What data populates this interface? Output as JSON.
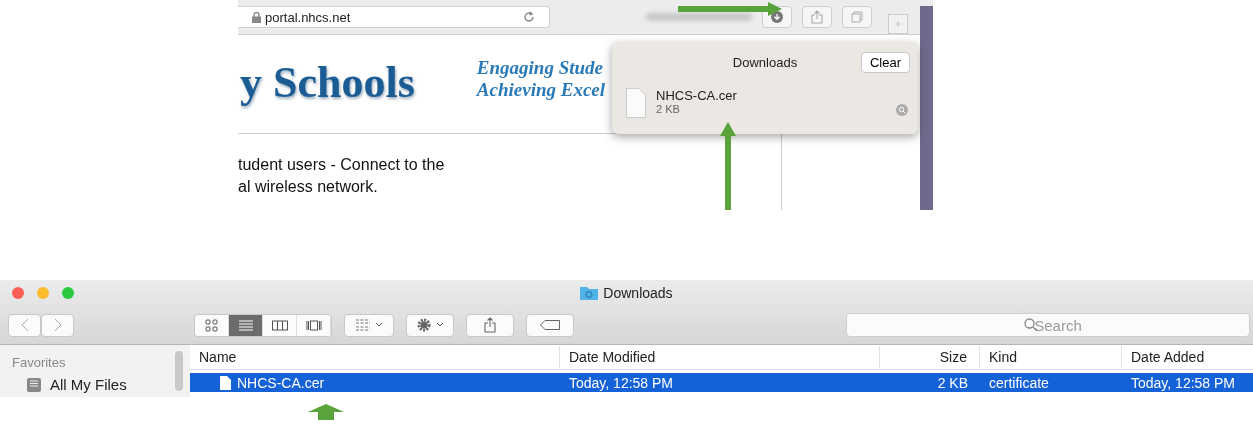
{
  "browser": {
    "address": "portal.nhcs.net",
    "page": {
      "logo_text": "y Schools",
      "tagline": [
        "Engaging Stude",
        "Achieving Excel"
      ],
      "body_text": [
        "tudent users - Connect to the",
        "al wireless network."
      ]
    },
    "downloads_popover": {
      "title": "Downloads",
      "clear_button": "Clear",
      "items": [
        {
          "name": "NHCS-CA.cer",
          "size": "2 KB"
        }
      ]
    }
  },
  "finder": {
    "title": "Downloads",
    "view_modes": [
      {
        "kind": "icons",
        "selected": false
      },
      {
        "kind": "list",
        "selected": true
      },
      {
        "kind": "columns",
        "selected": false
      },
      {
        "kind": "coverflow",
        "selected": false
      }
    ],
    "search": {
      "placeholder": "Search"
    },
    "sidebar": {
      "heading": "Favorites",
      "items": [
        {
          "label": "All My Files"
        }
      ]
    },
    "table": {
      "columns": [
        "Name",
        "Date Modified",
        "Size",
        "Kind",
        "Date Added"
      ],
      "rows": [
        {
          "cells": [
            "NHCS-CA.cer",
            "Today, 12:58 PM",
            "2 KB",
            "certificate",
            "Today, 12:58 PM"
          ],
          "selected": true
        }
      ]
    }
  }
}
